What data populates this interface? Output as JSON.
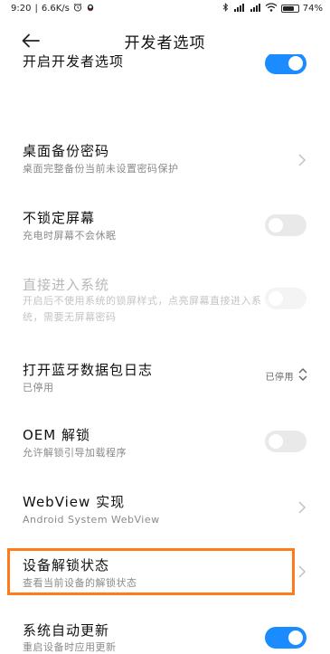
{
  "status_bar": {
    "time": "9:20",
    "net_speed": "6.6K/s",
    "battery_pct": "74",
    "battery_level": 0.74,
    "icons": [
      "alarm-icon",
      "app-notification-icon",
      "bluetooth-icon",
      "signal-icon",
      "signal-icon",
      "wifi-icon",
      "battery-icon"
    ]
  },
  "header": {
    "title": "开发者选项",
    "back_icon": "arrow-left-icon"
  },
  "rows": {
    "partial": {
      "title": "开启开发者选项",
      "toggle": "on"
    },
    "desktop_backup": {
      "title": "桌面备份密码",
      "subtitle": "桌面完整备份当前未设置密码保护"
    },
    "stay_awake": {
      "title": "不锁定屏幕",
      "subtitle": "充电时屏幕不会休眠",
      "toggle": "off"
    },
    "direct_entry": {
      "title": "直接进入系统",
      "subtitle": "开启后不使用系统的锁屏样式，点亮屏幕直接进入系统，需要无屏幕密码",
      "toggle": "disabled"
    },
    "bt_log": {
      "title": "打开蓝牙数据包日志",
      "subtitle": "已停用",
      "value": "已停用"
    },
    "oem_unlock": {
      "title": "OEM 解锁",
      "subtitle": "允许解锁引导加载程序",
      "toggle": "off"
    },
    "webview": {
      "title": "WebView 实现",
      "subtitle": "Android System WebView"
    },
    "unlock_status": {
      "title": "设备解锁状态",
      "subtitle": "查看当前设备的解锁状态"
    },
    "auto_update": {
      "title": "系统自动更新",
      "subtitle": "重启设备时应用更新",
      "toggle": "on"
    }
  },
  "colors": {
    "accent": "#1a8cff",
    "highlight": "#ff7a1a"
  }
}
